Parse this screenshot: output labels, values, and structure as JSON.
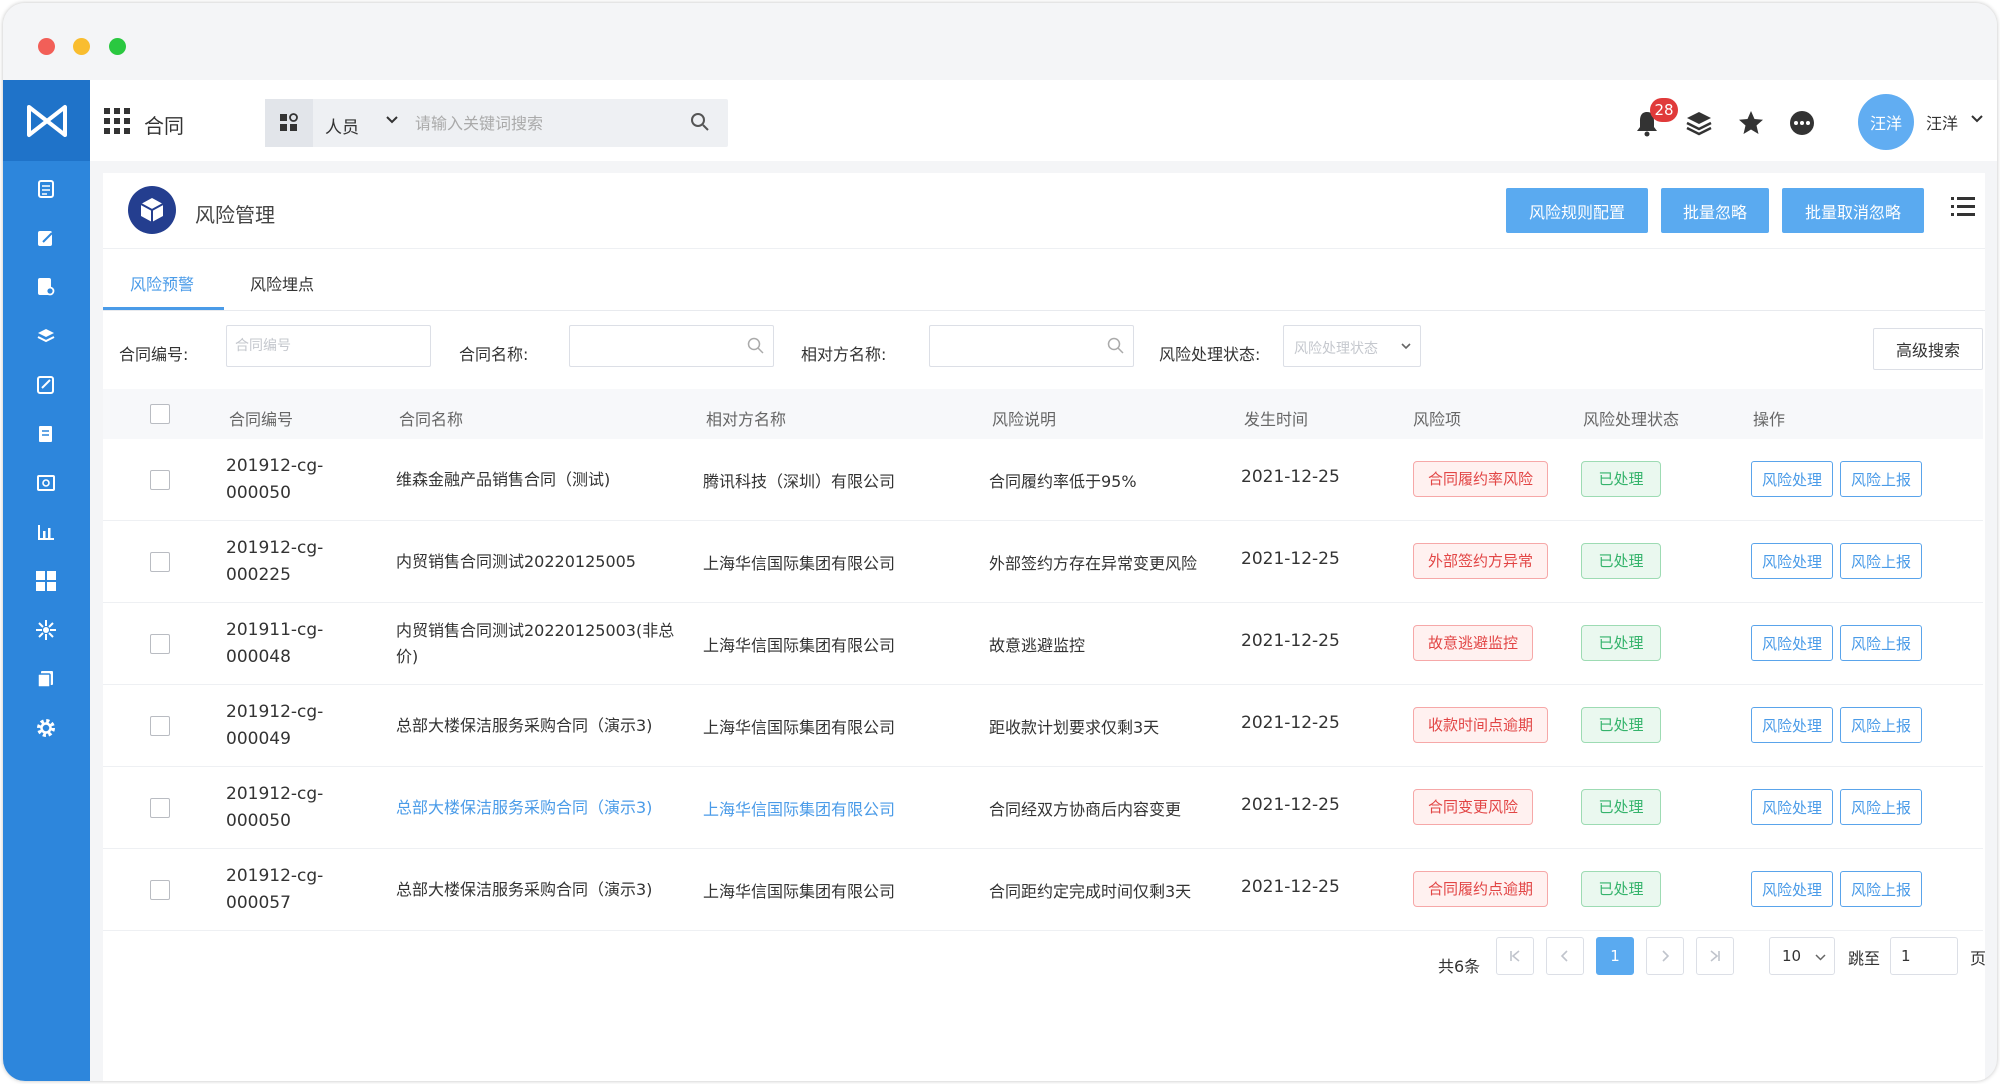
{
  "app": {
    "title": "合同",
    "brand_color": "#2d86dc"
  },
  "search": {
    "type_label": "人员",
    "placeholder": "请输入关键词搜索"
  },
  "topbar": {
    "notification_count": "28",
    "user_name": "汪洋",
    "avatar_text": "汪洋"
  },
  "sidebar": {
    "icons": [
      "document-icon",
      "edit-icon",
      "file-search-icon",
      "layers-icon",
      "contract-sign-icon",
      "report-icon",
      "search-doc-icon",
      "bar-chart-icon",
      "dashboard-icon",
      "flower-icon",
      "copy-icon",
      "gear-icon"
    ]
  },
  "page": {
    "title": "风险管理",
    "buttons": {
      "rule_config": "风险规则配置",
      "batch_ignore": "批量忽略",
      "batch_unignore": "批量取消忽略"
    }
  },
  "tabs": [
    {
      "label": "风险预警",
      "active": true
    },
    {
      "label": "风险埋点",
      "active": false
    }
  ],
  "filters": {
    "contract_no_label": "合同编号:",
    "contract_no_placeholder": "合同编号",
    "contract_name_label": "合同名称:",
    "party_label": "相对方名称:",
    "status_label": "风险处理状态:",
    "status_placeholder": "风险处理状态",
    "advanced_search": "高级搜索"
  },
  "table": {
    "headers": [
      "合同编号",
      "合同名称",
      "相对方名称",
      "风险说明",
      "发生时间",
      "风险项",
      "风险处理状态",
      "操作"
    ],
    "rows": [
      {
        "code_line1": "201912-cg-",
        "code_line2": "000050",
        "name": "维森金融产品销售合同（测试)",
        "party": "腾讯科技（深圳）有限公司",
        "desc": "合同履约率低于95%",
        "date": "2021-12-25",
        "risk": "合同履约率风险",
        "status": "已处理",
        "highlight": false
      },
      {
        "code_line1": "201912-cg-",
        "code_line2": "000225",
        "name": "内贸销售合同测试20220125005",
        "party": "上海华信国际集团有限公司",
        "desc": "外部签约方存在异常变更风险",
        "date": "2021-12-25",
        "risk": "外部签约方异常",
        "status": "已处理",
        "highlight": false
      },
      {
        "code_line1": "201911-cg-",
        "code_line2": "000048",
        "name": "内贸销售合同测试20220125003(非总价)",
        "party": "上海华信国际集团有限公司",
        "desc": "故意逃避监控",
        "date": "2021-12-25",
        "risk": "故意逃避监控",
        "status": "已处理",
        "highlight": false
      },
      {
        "code_line1": "201912-cg-",
        "code_line2": "000049",
        "name": "总部大楼保洁服务采购合同（演示3)",
        "party": "上海华信国际集团有限公司",
        "desc": "距收款计划要求仅剩3天",
        "date": "2021-12-25",
        "risk": "收款时间点逾期",
        "status": "已处理",
        "highlight": false
      },
      {
        "code_line1": "201912-cg-",
        "code_line2": "000050",
        "name": "总部大楼保洁服务采购合同（演示3)",
        "party": "上海华信国际集团有限公司",
        "desc": "合同经双方协商后内容变更",
        "date": "2021-12-25",
        "risk": "合同变更风险",
        "status": "已处理",
        "highlight": true
      },
      {
        "code_line1": "201912-cg-",
        "code_line2": "000057",
        "name": "总部大楼保洁服务采购合同（演示3)",
        "party": "上海华信国际集团有限公司",
        "desc": "合同距约定完成时间仅剩3天",
        "date": "2021-12-25",
        "risk": "合同履约点逾期",
        "status": "已处理",
        "highlight": false
      }
    ],
    "actions": {
      "handle": "风险处理",
      "report": "风险上报"
    }
  },
  "pagination": {
    "total": "共6条",
    "current_page": "1",
    "page_size": "10",
    "jump_label": "跳至",
    "jump_value": "1",
    "page_suffix": "页"
  }
}
